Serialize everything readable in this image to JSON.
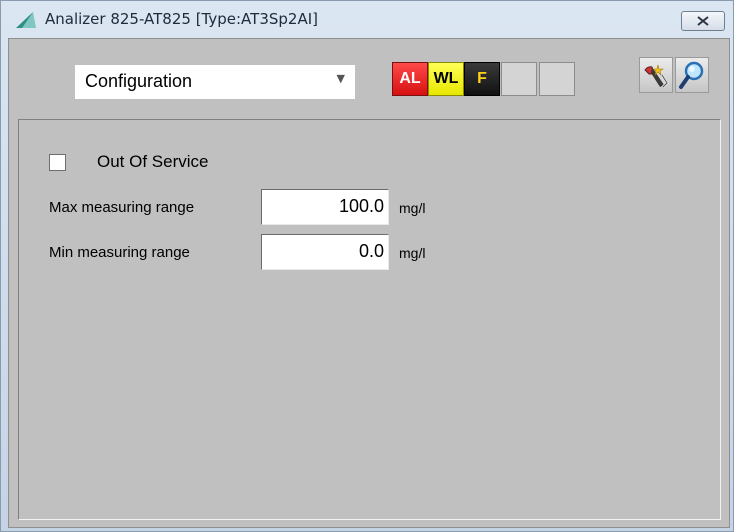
{
  "window": {
    "title": "Analizer 825-AT825  [Type:AT3Sp2AI]",
    "icons": {
      "app": "wedge-icon",
      "close": "close-x-icon"
    }
  },
  "toolbar": {
    "view_selector": {
      "value": "Configuration"
    },
    "status_indicators": [
      {
        "label": "AL",
        "color": "#e31b1b"
      },
      {
        "label": "WL",
        "color": "#f1f000"
      },
      {
        "label": "F",
        "color": "#1a1a1a"
      },
      {
        "label": "",
        "color": "#d4d4d4"
      },
      {
        "label": "",
        "color": "#d4d4d4"
      }
    ],
    "tool_icons": [
      "configure-icon",
      "search-icon"
    ]
  },
  "form": {
    "out_of_service": {
      "label": "Out Of Service",
      "checked": false
    },
    "fields": [
      {
        "label": "Max measuring range",
        "value": "100.0",
        "unit": "mg/l"
      },
      {
        "label": "Min measuring range",
        "value": "0.0",
        "unit": "mg/l"
      }
    ]
  }
}
